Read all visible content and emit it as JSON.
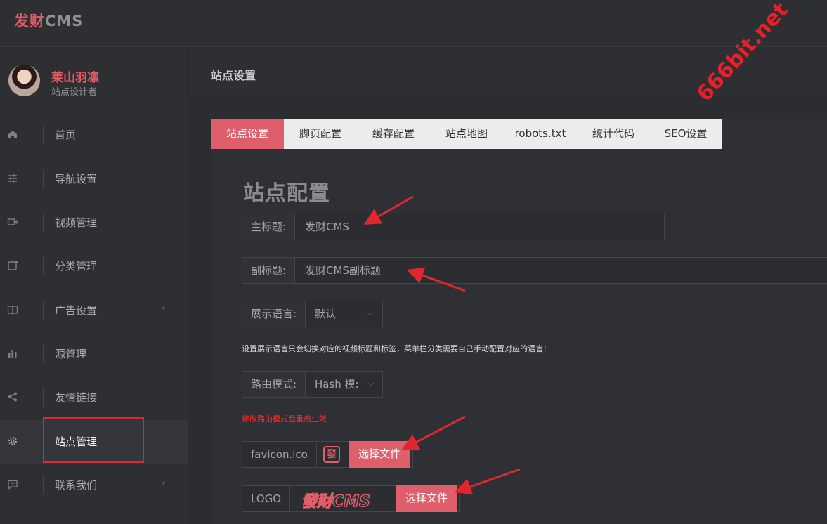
{
  "app": {
    "brand_part1": "发财",
    "brand_part2": "CMS"
  },
  "user": {
    "name": "莱山羽凛",
    "role": "站点设计者"
  },
  "sidebar": {
    "items": [
      {
        "label": "首页",
        "icon": "home-icon"
      },
      {
        "label": "导航设置",
        "icon": "sliders-icon"
      },
      {
        "label": "视频管理",
        "icon": "video-icon"
      },
      {
        "label": "分类管理",
        "icon": "category-icon"
      },
      {
        "label": "广告设置",
        "icon": "book-icon",
        "arrow": "‹"
      },
      {
        "label": "源管理",
        "icon": "bar-chart-icon"
      },
      {
        "label": "友情链接",
        "icon": "share-icon"
      },
      {
        "label": "站点管理",
        "icon": "gear-icon"
      },
      {
        "label": "联系我们",
        "icon": "message-icon",
        "arrow": "‹"
      }
    ],
    "active_index": 7
  },
  "header": {
    "title": "站点设置"
  },
  "tabs": [
    {
      "label": "站点设置"
    },
    {
      "label": "脚页配置"
    },
    {
      "label": "缓存配置"
    },
    {
      "label": "站点地图"
    },
    {
      "label": "robots.txt"
    },
    {
      "label": "统计代码"
    },
    {
      "label": "SEO设置"
    }
  ],
  "form": {
    "section_title": "站点配置",
    "main_title": {
      "label": "主标题:",
      "value": "发财CMS"
    },
    "sub_title": {
      "label": "副标题:",
      "value": "发财CMS副标题"
    },
    "language": {
      "label": "展示语言:",
      "value": "默认"
    },
    "language_hint": "设置展示语言只会切换对应的视频标题和标签，菜单栏分类需要自己手动配置对应的语言！",
    "route_mode": {
      "label": "路由模式:",
      "value": "Hash 模:"
    },
    "route_warning": "修改路由模式后重启生效",
    "favicon": {
      "label": "favicon.ico",
      "preview": "發",
      "button": "选择文件"
    },
    "logo": {
      "label": "LOGO",
      "preview": "發財CMS",
      "button": "选择文件"
    }
  },
  "watermark": "666bit.net",
  "colors": {
    "accent": "#df5e6b",
    "annotation": "#e0262e",
    "background": "#2b2d31"
  }
}
